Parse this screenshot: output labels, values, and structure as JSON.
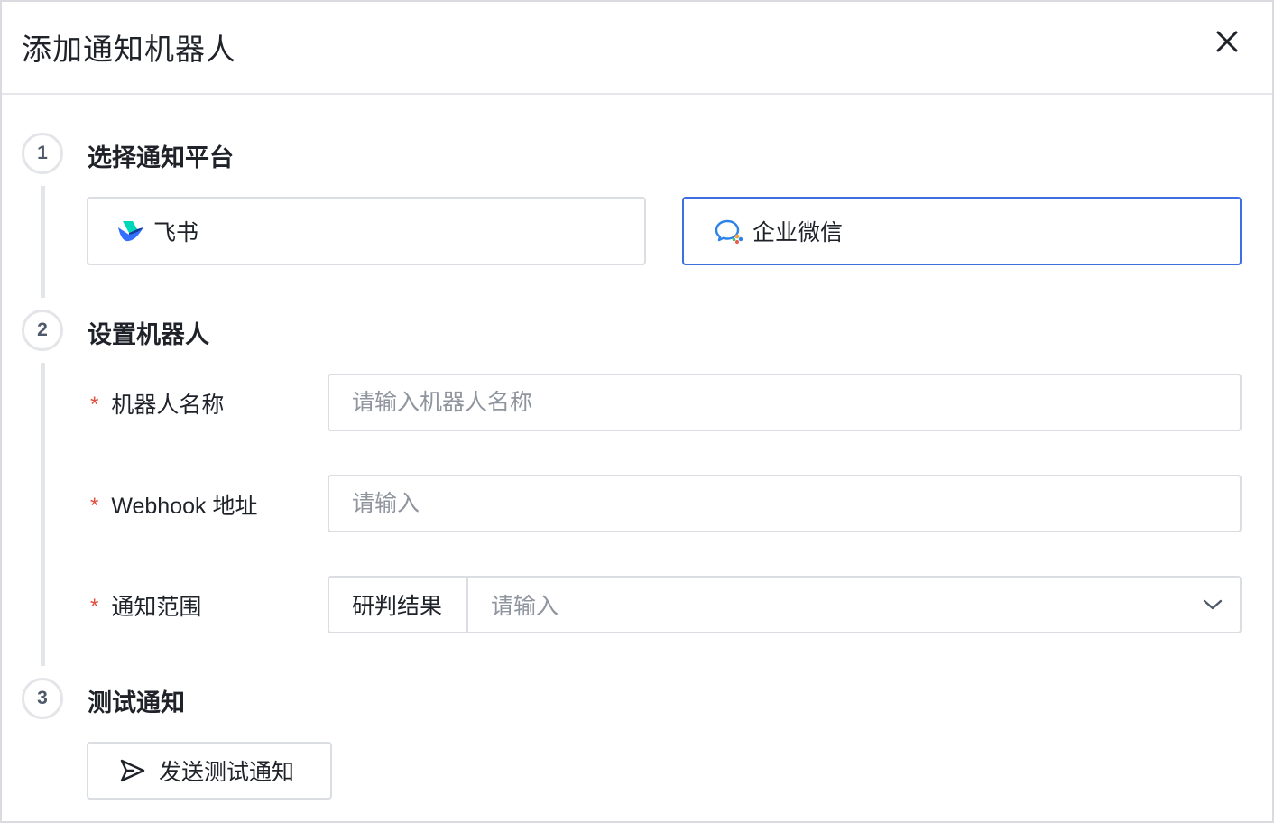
{
  "dialog": {
    "title": "添加通知机器人"
  },
  "steps": [
    {
      "number": "1",
      "title": "选择通知平台"
    },
    {
      "number": "2",
      "title": "设置机器人"
    },
    {
      "number": "3",
      "title": "测试通知"
    }
  ],
  "platforms": [
    {
      "name": "飞书",
      "icon": "feishu-logo-icon",
      "selected": false
    },
    {
      "name": "企业微信",
      "icon": "wecom-logo-icon",
      "selected": true
    }
  ],
  "form": {
    "required_mark": "*",
    "robot_name": {
      "label": "机器人名称",
      "placeholder": "请输入机器人名称",
      "value": ""
    },
    "webhook": {
      "label": "Webhook 地址",
      "placeholder": "请输入",
      "value": ""
    },
    "scope": {
      "label": "通知范围",
      "prefix": "研判结果",
      "placeholder": "请输入"
    }
  },
  "test": {
    "button_label": "发送测试通知",
    "icon": "send-icon"
  },
  "colors": {
    "accent": "#3d6fe0",
    "required": "#e34d3d",
    "border": "#dadde2"
  }
}
